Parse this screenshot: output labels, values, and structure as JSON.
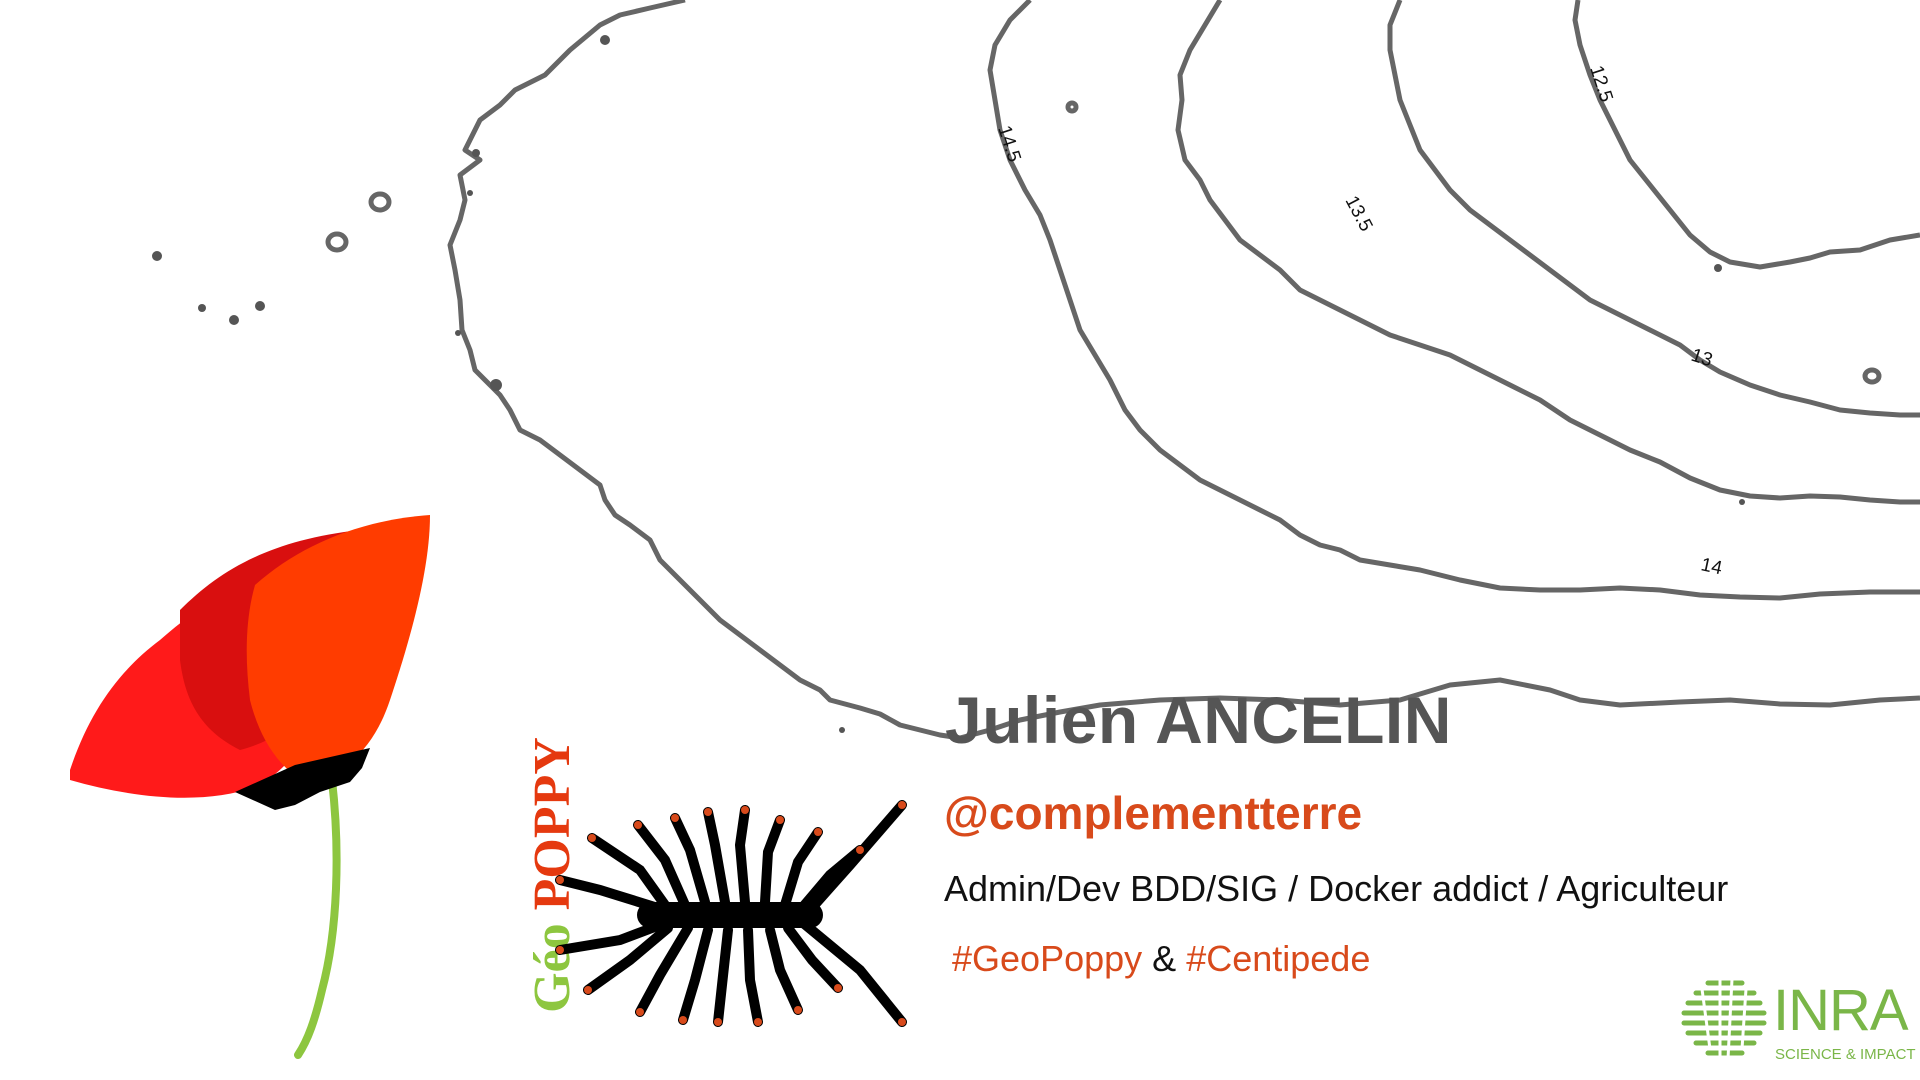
{
  "presenter": {
    "name": "Julien ANCELIN",
    "handle": "@complementterre",
    "roles": "Admin/Dev BDD/SIG / Docker addict / Agriculteur",
    "tag1": "#GeoPoppy",
    "amp": "&",
    "tag2": "#Centipede"
  },
  "logo_geopoppy": {
    "geo": "Géo",
    "poppy": "POPPY"
  },
  "logo_inra": {
    "name": "INRA",
    "tagline": "SCIENCE & IMPACT"
  },
  "contour_labels": [
    "14.5",
    "13.5",
    "12.5",
    "13",
    "14"
  ],
  "colors": {
    "contour": "#666666",
    "accent": "#d84a1b",
    "name": "#555555",
    "geo": "#8dc63f",
    "poppy": "#e5390f",
    "inra": "#7ab648"
  }
}
